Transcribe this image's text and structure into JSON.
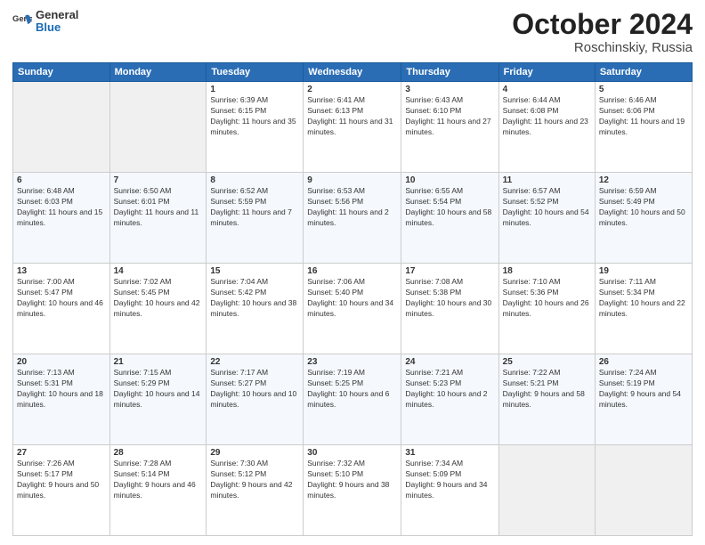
{
  "logo": {
    "general": "General",
    "blue": "Blue"
  },
  "header": {
    "title": "October 2024",
    "subtitle": "Roschinskiy, Russia"
  },
  "days": [
    "Sunday",
    "Monday",
    "Tuesday",
    "Wednesday",
    "Thursday",
    "Friday",
    "Saturday"
  ],
  "weeks": [
    [
      {
        "date": "",
        "sunrise": "",
        "sunset": "",
        "daylight": ""
      },
      {
        "date": "",
        "sunrise": "",
        "sunset": "",
        "daylight": ""
      },
      {
        "date": "1",
        "sunrise": "Sunrise: 6:39 AM",
        "sunset": "Sunset: 6:15 PM",
        "daylight": "Daylight: 11 hours and 35 minutes."
      },
      {
        "date": "2",
        "sunrise": "Sunrise: 6:41 AM",
        "sunset": "Sunset: 6:13 PM",
        "daylight": "Daylight: 11 hours and 31 minutes."
      },
      {
        "date": "3",
        "sunrise": "Sunrise: 6:43 AM",
        "sunset": "Sunset: 6:10 PM",
        "daylight": "Daylight: 11 hours and 27 minutes."
      },
      {
        "date": "4",
        "sunrise": "Sunrise: 6:44 AM",
        "sunset": "Sunset: 6:08 PM",
        "daylight": "Daylight: 11 hours and 23 minutes."
      },
      {
        "date": "5",
        "sunrise": "Sunrise: 6:46 AM",
        "sunset": "Sunset: 6:06 PM",
        "daylight": "Daylight: 11 hours and 19 minutes."
      }
    ],
    [
      {
        "date": "6",
        "sunrise": "Sunrise: 6:48 AM",
        "sunset": "Sunset: 6:03 PM",
        "daylight": "Daylight: 11 hours and 15 minutes."
      },
      {
        "date": "7",
        "sunrise": "Sunrise: 6:50 AM",
        "sunset": "Sunset: 6:01 PM",
        "daylight": "Daylight: 11 hours and 11 minutes."
      },
      {
        "date": "8",
        "sunrise": "Sunrise: 6:52 AM",
        "sunset": "Sunset: 5:59 PM",
        "daylight": "Daylight: 11 hours and 7 minutes."
      },
      {
        "date": "9",
        "sunrise": "Sunrise: 6:53 AM",
        "sunset": "Sunset: 5:56 PM",
        "daylight": "Daylight: 11 hours and 2 minutes."
      },
      {
        "date": "10",
        "sunrise": "Sunrise: 6:55 AM",
        "sunset": "Sunset: 5:54 PM",
        "daylight": "Daylight: 10 hours and 58 minutes."
      },
      {
        "date": "11",
        "sunrise": "Sunrise: 6:57 AM",
        "sunset": "Sunset: 5:52 PM",
        "daylight": "Daylight: 10 hours and 54 minutes."
      },
      {
        "date": "12",
        "sunrise": "Sunrise: 6:59 AM",
        "sunset": "Sunset: 5:49 PM",
        "daylight": "Daylight: 10 hours and 50 minutes."
      }
    ],
    [
      {
        "date": "13",
        "sunrise": "Sunrise: 7:00 AM",
        "sunset": "Sunset: 5:47 PM",
        "daylight": "Daylight: 10 hours and 46 minutes."
      },
      {
        "date": "14",
        "sunrise": "Sunrise: 7:02 AM",
        "sunset": "Sunset: 5:45 PM",
        "daylight": "Daylight: 10 hours and 42 minutes."
      },
      {
        "date": "15",
        "sunrise": "Sunrise: 7:04 AM",
        "sunset": "Sunset: 5:42 PM",
        "daylight": "Daylight: 10 hours and 38 minutes."
      },
      {
        "date": "16",
        "sunrise": "Sunrise: 7:06 AM",
        "sunset": "Sunset: 5:40 PM",
        "daylight": "Daylight: 10 hours and 34 minutes."
      },
      {
        "date": "17",
        "sunrise": "Sunrise: 7:08 AM",
        "sunset": "Sunset: 5:38 PM",
        "daylight": "Daylight: 10 hours and 30 minutes."
      },
      {
        "date": "18",
        "sunrise": "Sunrise: 7:10 AM",
        "sunset": "Sunset: 5:36 PM",
        "daylight": "Daylight: 10 hours and 26 minutes."
      },
      {
        "date": "19",
        "sunrise": "Sunrise: 7:11 AM",
        "sunset": "Sunset: 5:34 PM",
        "daylight": "Daylight: 10 hours and 22 minutes."
      }
    ],
    [
      {
        "date": "20",
        "sunrise": "Sunrise: 7:13 AM",
        "sunset": "Sunset: 5:31 PM",
        "daylight": "Daylight: 10 hours and 18 minutes."
      },
      {
        "date": "21",
        "sunrise": "Sunrise: 7:15 AM",
        "sunset": "Sunset: 5:29 PM",
        "daylight": "Daylight: 10 hours and 14 minutes."
      },
      {
        "date": "22",
        "sunrise": "Sunrise: 7:17 AM",
        "sunset": "Sunset: 5:27 PM",
        "daylight": "Daylight: 10 hours and 10 minutes."
      },
      {
        "date": "23",
        "sunrise": "Sunrise: 7:19 AM",
        "sunset": "Sunset: 5:25 PM",
        "daylight": "Daylight: 10 hours and 6 minutes."
      },
      {
        "date": "24",
        "sunrise": "Sunrise: 7:21 AM",
        "sunset": "Sunset: 5:23 PM",
        "daylight": "Daylight: 10 hours and 2 minutes."
      },
      {
        "date": "25",
        "sunrise": "Sunrise: 7:22 AM",
        "sunset": "Sunset: 5:21 PM",
        "daylight": "Daylight: 9 hours and 58 minutes."
      },
      {
        "date": "26",
        "sunrise": "Sunrise: 7:24 AM",
        "sunset": "Sunset: 5:19 PM",
        "daylight": "Daylight: 9 hours and 54 minutes."
      }
    ],
    [
      {
        "date": "27",
        "sunrise": "Sunrise: 7:26 AM",
        "sunset": "Sunset: 5:17 PM",
        "daylight": "Daylight: 9 hours and 50 minutes."
      },
      {
        "date": "28",
        "sunrise": "Sunrise: 7:28 AM",
        "sunset": "Sunset: 5:14 PM",
        "daylight": "Daylight: 9 hours and 46 minutes."
      },
      {
        "date": "29",
        "sunrise": "Sunrise: 7:30 AM",
        "sunset": "Sunset: 5:12 PM",
        "daylight": "Daylight: 9 hours and 42 minutes."
      },
      {
        "date": "30",
        "sunrise": "Sunrise: 7:32 AM",
        "sunset": "Sunset: 5:10 PM",
        "daylight": "Daylight: 9 hours and 38 minutes."
      },
      {
        "date": "31",
        "sunrise": "Sunrise: 7:34 AM",
        "sunset": "Sunset: 5:09 PM",
        "daylight": "Daylight: 9 hours and 34 minutes."
      },
      {
        "date": "",
        "sunrise": "",
        "sunset": "",
        "daylight": ""
      },
      {
        "date": "",
        "sunrise": "",
        "sunset": "",
        "daylight": ""
      }
    ]
  ]
}
